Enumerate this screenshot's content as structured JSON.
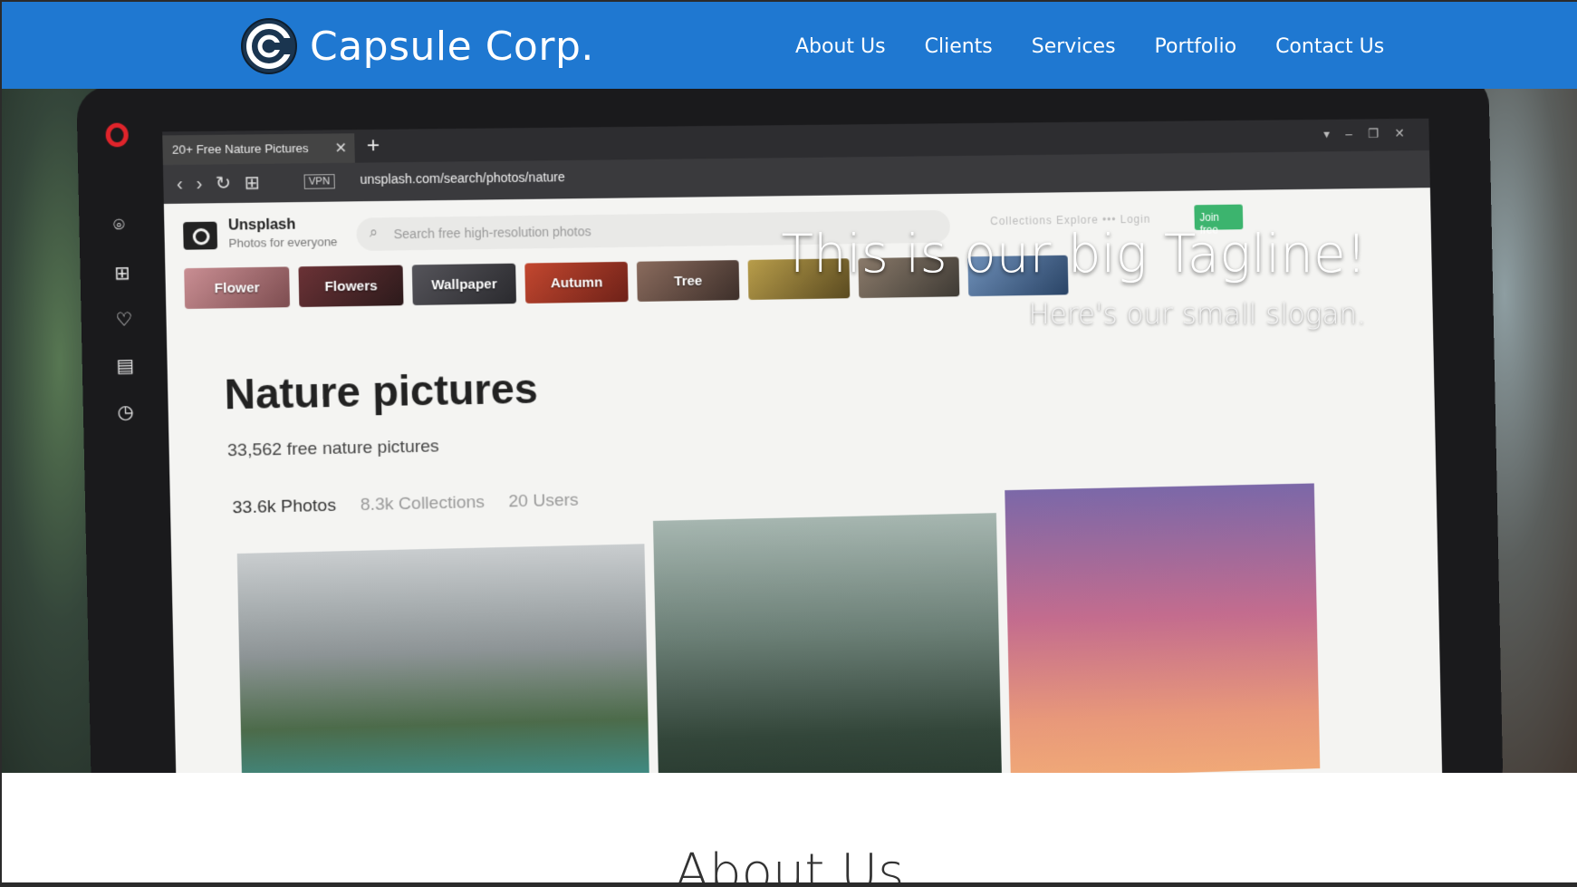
{
  "header": {
    "brand": "Capsule Corp.",
    "nav": [
      "About Us",
      "Clients",
      "Services",
      "Portfolio",
      "Contact Us"
    ],
    "accent": "#1f78d1"
  },
  "hero": {
    "tagline": "This is our big Tagline!",
    "slogan": "Here's our small slogan.",
    "screen": {
      "tab_title": "20+ Free Nature Pictures",
      "url": "unsplash.com/search/photos/nature",
      "vpn": "VPN",
      "site_name": "Unsplash",
      "site_tagline": "Photos for everyone",
      "search_placeholder": "Search free high-resolution photos",
      "header_links": "Collections   Explore   •••     Login",
      "join_label": "Join free",
      "chips": [
        "Flower",
        "Flowers",
        "Wallpaper",
        "Autumn",
        "Tree"
      ],
      "page_title": "Nature pictures",
      "count": "33,562 free nature pictures",
      "stats": [
        "33.6k Photos",
        "8.3k Collections",
        "20 Users"
      ]
    }
  },
  "about": {
    "title": "About Us"
  }
}
